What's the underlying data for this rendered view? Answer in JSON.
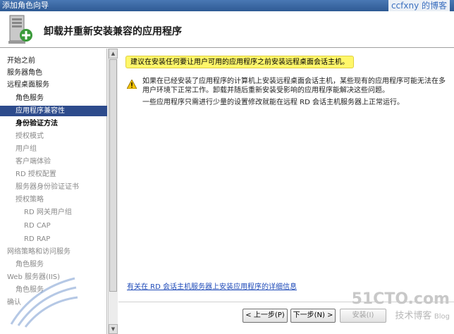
{
  "window": {
    "title": "添加角色向导",
    "watermark_top": "ccfxny 的博客"
  },
  "header": {
    "title": "卸载并重新安装兼容的应用程序"
  },
  "sidebar": {
    "items": [
      {
        "label": "开始之前"
      },
      {
        "label": "服务器角色"
      },
      {
        "label": "远程桌面服务"
      },
      {
        "label": "角色服务"
      },
      {
        "label": "应用程序兼容性"
      },
      {
        "label": "身份验证方法"
      },
      {
        "label": "授权模式"
      },
      {
        "label": "用户组"
      },
      {
        "label": "客户端体验"
      },
      {
        "label": "RD 授权配置"
      },
      {
        "label": "服务器身份验证证书"
      },
      {
        "label": "授权策略"
      },
      {
        "label": "RD 网关用户组"
      },
      {
        "label": "RD CAP"
      },
      {
        "label": "RD RAP"
      },
      {
        "label": "网络策略和访问服务"
      },
      {
        "label": "角色服务"
      },
      {
        "label": "Web 服务器(IIS)"
      },
      {
        "label": "角色服务"
      },
      {
        "label": "确认"
      }
    ]
  },
  "main": {
    "highlight_text": "建议在安装任何要让用户可用的应用程序之前安装远程桌面会话主机。",
    "warning_text": "如果在已经安装了应用程序的计算机上安装远程桌面会话主机，某些现有的应用程序可能无法在多用户环境下正常工作。卸载并随后重新安装受影响的应用程序能解决这些问题。",
    "info_text": "一些应用程序只需进行少量的设置修改就能在远程 RD 会话主机服务器上正常运行。",
    "more_link": "有关在 RD 会话主机服务器上安装应用程序的详细信息"
  },
  "footer": {
    "prev_label": "< 上一步(P)",
    "next_label": "下一步(N) >",
    "install_label": "安装(I)"
  },
  "watermarks": {
    "site": "51CTO.com",
    "site_cn": "技术博客",
    "blog": "Blog"
  },
  "colors": {
    "selected_bg": "#2d4b8c",
    "highlight_bg": "#fff76a",
    "link": "#1e4ab8"
  }
}
